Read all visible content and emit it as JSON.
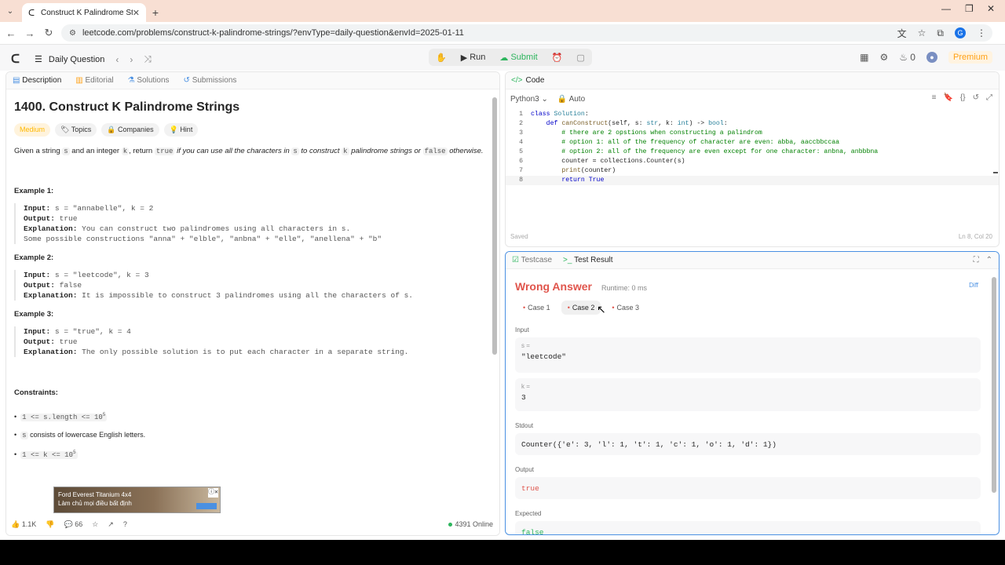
{
  "browser": {
    "tab_title": "Construct K Palindrome Strings",
    "url": "leetcode.com/problems/construct-k-palindrome-strings/?envType=daily-question&envId=2025-01-11"
  },
  "lc_nav": {
    "daily_question": "Daily Question",
    "run": "Run",
    "submit": "Submit",
    "streak_count": "0",
    "premium": "Premium"
  },
  "left_tabs": {
    "description": "Description",
    "editorial": "Editorial",
    "solutions": "Solutions",
    "submissions": "Submissions"
  },
  "problem": {
    "title": "1400. Construct K Palindrome Strings",
    "difficulty": "Medium",
    "topics": "Topics",
    "companies": "Companies",
    "hint": "Hint",
    "text": {
      "p1": "Given a string ",
      "s": "s",
      "p2": " and an integer ",
      "k": "k",
      "p3": ", return ",
      "true": "true",
      "p4": " if you can use all the characters in ",
      "s2": "s",
      "p5": " to construct ",
      "k2": "k",
      "p6": " palindrome strings or ",
      "false": "false",
      "p7": " otherwise."
    },
    "examples": [
      {
        "heading": "Example 1:",
        "input": "s = \"annabelle\", k = 2",
        "output": "true",
        "explanation": "You can construct two palindromes using all characters in s.",
        "extra": "Some possible constructions \"anna\" + \"elble\", \"anbna\" + \"elle\", \"anellena\" + \"b\""
      },
      {
        "heading": "Example 2:",
        "input": "s = \"leetcode\", k = 3",
        "output": "false",
        "explanation": "It is impossible to construct 3 palindromes using all the characters of s."
      },
      {
        "heading": "Example 3:",
        "input": "s = \"true\", k = 4",
        "output": "true",
        "explanation": "The only possible solution is to put each character in a separate string."
      }
    ],
    "labels": {
      "input": "Input:",
      "output": "Output:",
      "explanation": "Explanation:"
    },
    "constraints_heading": "Constraints:",
    "constraints": [
      "1 <= s.length <= 10",
      "s",
      " consists of lowercase English letters.",
      "1 <= k <= 10"
    ],
    "constraint_exp": "5"
  },
  "footer": {
    "likes": "1.1K",
    "comments": "66",
    "online": "4391 Online"
  },
  "ad": {
    "line1": "Ford Everest Titanium 4x4",
    "line2": "Làm chủ mọi điều bất định"
  },
  "editor": {
    "header": "Code",
    "language": "Python3",
    "auto": "Auto",
    "saved": "Saved",
    "position": "Ln 8, Col 20"
  },
  "testpanel": {
    "testcase_tab": "Testcase",
    "result_tab": "Test Result",
    "verdict": "Wrong Answer",
    "runtime": "Runtime: 0 ms",
    "diff": "Diff",
    "cases": [
      "Case 1",
      "Case 2",
      "Case 3"
    ],
    "input_label": "Input",
    "var_s": "s =",
    "val_s": "\"leetcode\"",
    "var_k": "k =",
    "val_k": "3",
    "stdout_label": "Stdout",
    "stdout": "Counter({'e': 3, 'l': 1, 't': 1, 'c': 1, 'o': 1, 'd': 1})",
    "output_label": "Output",
    "output": "true",
    "expected_label": "Expected",
    "expected": "false"
  }
}
